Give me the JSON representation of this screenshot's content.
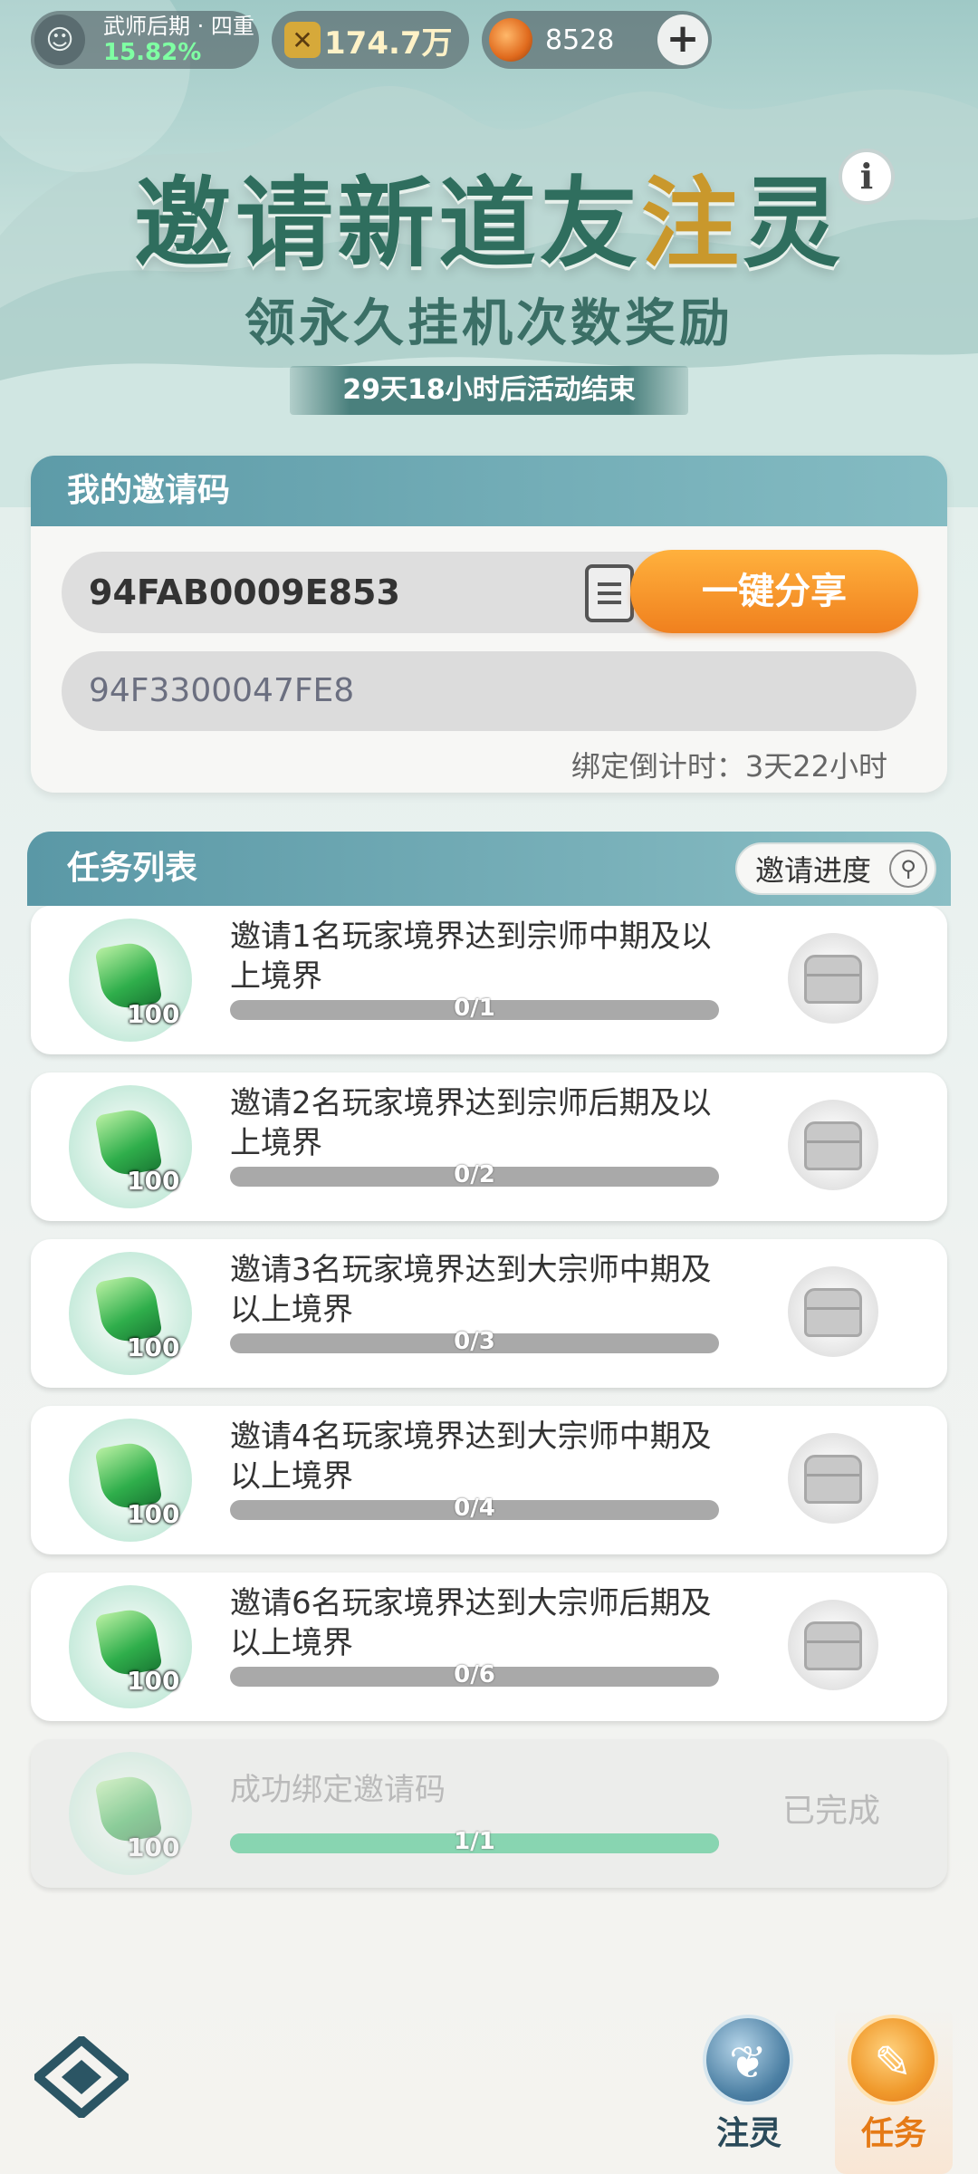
{
  "topbar": {
    "rank_title": "武师后期 · 四重",
    "rank_progress": "15.82%",
    "power_value": "174.7万",
    "currency_value": "8528",
    "add_button": "+"
  },
  "header": {
    "title_part1": "邀请新道友",
    "title_highlight": "注",
    "title_part2": "灵",
    "subtitle": "领永久挂机次数奖励",
    "info_button": "i",
    "event_timer": "29天18小时后活动结束"
  },
  "invite_code": {
    "heading": "我的邀请码",
    "my_code": "94FAB0009E853",
    "share_button": "一键分享",
    "bound_code": "94F3300047FE8",
    "bind_countdown": "绑定倒计时：3天22小时"
  },
  "task_list": {
    "heading": "任务列表",
    "progress_button": "邀请进度",
    "tasks": [
      {
        "reward": "100",
        "desc": "邀请1名玩家境界达到宗师中期及以上境界",
        "progress_text": "0/1",
        "progress": 0.0
      },
      {
        "reward": "100",
        "desc": "邀请2名玩家境界达到宗师后期及以上境界",
        "progress_text": "0/2",
        "progress": 0.0
      },
      {
        "reward": "100",
        "desc": "邀请3名玩家境界达到大宗师中期及以上境界",
        "progress_text": "0/3",
        "progress": 0.0
      },
      {
        "reward": "100",
        "desc": "邀请4名玩家境界达到大宗师中期及以上境界",
        "progress_text": "0/4",
        "progress": 0.0
      },
      {
        "reward": "100",
        "desc": "邀请6名玩家境界达到大宗师后期及以上境界",
        "progress_text": "0/6",
        "progress": 0.0
      },
      {
        "reward": "100",
        "desc": "成功绑定邀请码",
        "progress_text": "1/1",
        "progress": 1.0,
        "status": "已完成"
      }
    ]
  },
  "bottom_nav": {
    "inject_label": "注灵",
    "task_label": "任务"
  },
  "colors": {
    "accent_orange": "#f0801e",
    "header_teal": "#5d9ba8",
    "title_green": "#2f6e5e"
  }
}
